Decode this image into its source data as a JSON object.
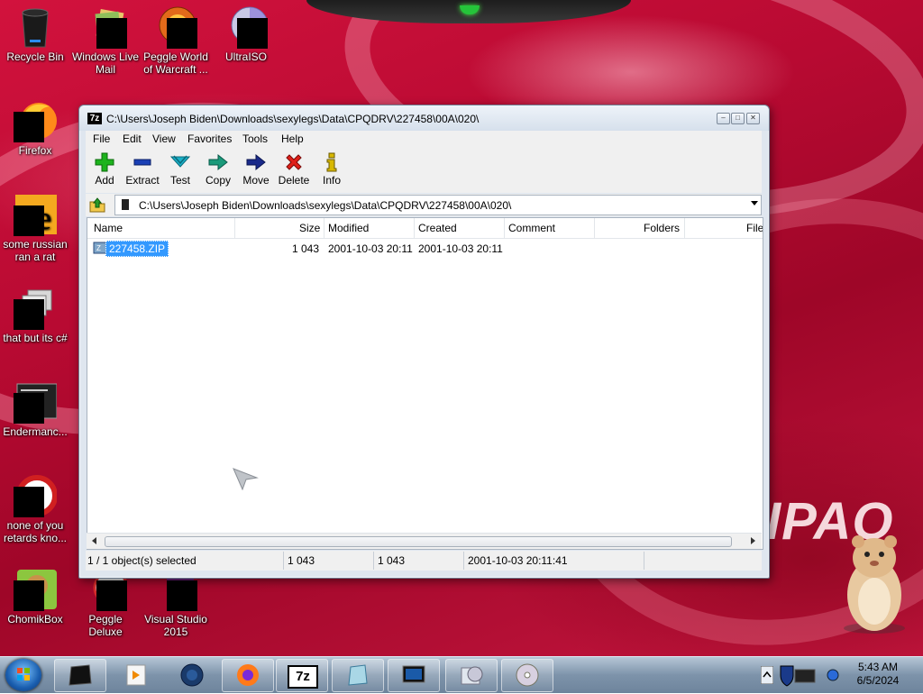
{
  "desktop": {
    "brand_text": "IPAQ",
    "icons": [
      {
        "label": "Recycle Bin"
      },
      {
        "label": "Windows Live Mail"
      },
      {
        "label": "Peggle World of Warcraft ..."
      },
      {
        "label": "UltraISO"
      },
      {
        "label": "Firefox"
      },
      {
        "label": "some russian ran a rat"
      },
      {
        "label": "that but its c#"
      },
      {
        "label": "Endermanc..."
      },
      {
        "label": "none of you retards kno..."
      },
      {
        "label": "ChomikBox"
      },
      {
        "label": "Peggle Deluxe"
      },
      {
        "label": "Visual Studio 2015"
      }
    ]
  },
  "window": {
    "app_icon_text": "7z",
    "title": "C:\\Users\\Joseph Biden\\Downloads\\sexylegs\\Data\\CPQDRV\\227458\\00A\\020\\",
    "menu": [
      "File",
      "Edit",
      "View",
      "Favorites",
      "Tools",
      "Help"
    ],
    "toolbar": [
      {
        "label": "Add",
        "icon": "add-icon",
        "color": "#1db31d"
      },
      {
        "label": "Extract",
        "icon": "extract-icon",
        "color": "#1a3fb5"
      },
      {
        "label": "Test",
        "icon": "test-icon",
        "color": "#1ab0c8"
      },
      {
        "label": "Copy",
        "icon": "copy-icon",
        "color": "#1a9a7a"
      },
      {
        "label": "Move",
        "icon": "move-icon",
        "color": "#1a2a8a"
      },
      {
        "label": "Delete",
        "icon": "delete-icon",
        "color": "#e0201a"
      },
      {
        "label": "Info",
        "icon": "info-icon",
        "color": "#d8b800"
      }
    ],
    "address": "C:\\Users\\Joseph Biden\\Downloads\\sexylegs\\Data\\CPQDRV\\227458\\00A\\020\\",
    "columns": [
      "Name",
      "Size",
      "Modified",
      "Created",
      "Comment",
      "Folders",
      "File"
    ],
    "rows": [
      {
        "name": "227458.ZIP",
        "size": "1 043",
        "modified": "2001-10-03 20:11",
        "created": "2001-10-03 20:11",
        "comment": "",
        "folders": "",
        "files": "",
        "selected": true
      }
    ],
    "status": {
      "selection": "1 / 1 object(s) selected",
      "size": "1 043",
      "packed": "1 043",
      "modified": "2001-10-03 20:11:41"
    }
  },
  "taskbar": {
    "clock_time": "5:43 AM",
    "clock_date": "6/5/2024",
    "buttons": [
      {
        "icon": "dark-window-icon"
      },
      {
        "icon": "media-player-icon"
      },
      {
        "icon": "globe-icon"
      },
      {
        "icon": "firefox-icon"
      },
      {
        "icon": "7zip-icon",
        "text": "7z"
      },
      {
        "icon": "blue-app-icon"
      },
      {
        "icon": "monitor-icon"
      },
      {
        "icon": "media-center-icon"
      },
      {
        "icon": "disc-icon"
      }
    ]
  }
}
